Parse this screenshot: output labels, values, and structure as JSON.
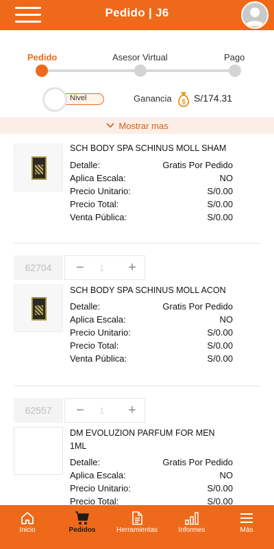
{
  "header": {
    "title": "Pedido | J6"
  },
  "steps": {
    "items": [
      {
        "label": "Pedido",
        "active": true
      },
      {
        "label": "Asesor Virtual",
        "active": false
      },
      {
        "label": "Pago",
        "active": false
      }
    ]
  },
  "summary": {
    "nivel_label": "Nivel",
    "ganancia_label": "Ganancia",
    "ganancia_value": "S/174.31",
    "mostrar_label": "Mostrar mas"
  },
  "products": [
    {
      "sku": "",
      "qty": "",
      "name_line1": "SCH BODY SPA SCHINUS MOLL SHAM",
      "name_line2": "",
      "details": [
        {
          "k": "Detalle:",
          "v": "Gratis Por Pedido"
        },
        {
          "k": "Aplica Escala:",
          "v": "NO"
        },
        {
          "k": "Precio Unitario:",
          "v": "S/0.00"
        },
        {
          "k": "Precio Total:",
          "v": "S/0.00"
        },
        {
          "k": "Venta Pública:",
          "v": "S/0.00"
        }
      ]
    },
    {
      "sku": "62704",
      "qty": "1",
      "name_line1": "SCH BODY SPA SCHINUS MOLL ACON",
      "name_line2": "",
      "details": [
        {
          "k": "Detalle:",
          "v": "Gratis Por Pedido"
        },
        {
          "k": "Aplica Escala:",
          "v": "NO"
        },
        {
          "k": "Precio Unitario:",
          "v": "S/0.00"
        },
        {
          "k": "Precio Total:",
          "v": "S/0.00"
        },
        {
          "k": "Venta Pública:",
          "v": "S/0.00"
        }
      ]
    },
    {
      "sku": "62557",
      "qty": "1",
      "name_line1": "DM EVOLUZION PARFUM FOR MEN",
      "name_line2": "1ML",
      "details": [
        {
          "k": "Detalle:",
          "v": "Gratis Por Pedido"
        },
        {
          "k": "Aplica Escala:",
          "v": "NO"
        },
        {
          "k": "Precio Unitario:",
          "v": "S/0.00"
        },
        {
          "k": "Precio Total:",
          "v": "S/0.00"
        }
      ]
    }
  ],
  "bottom_nav": {
    "items": [
      {
        "label": "Inicio",
        "icon": "home-icon"
      },
      {
        "label": "Pedidos",
        "icon": "cart-icon",
        "active": true
      },
      {
        "label": "Herramientas",
        "icon": "document-icon"
      },
      {
        "label": "Informes",
        "icon": "bar-chart-icon"
      },
      {
        "label": "Más",
        "icon": "menu-icon"
      }
    ]
  },
  "colors": {
    "accent": "#ee6a1a",
    "soft_bg": "#fbeee6",
    "text": "#111111"
  }
}
